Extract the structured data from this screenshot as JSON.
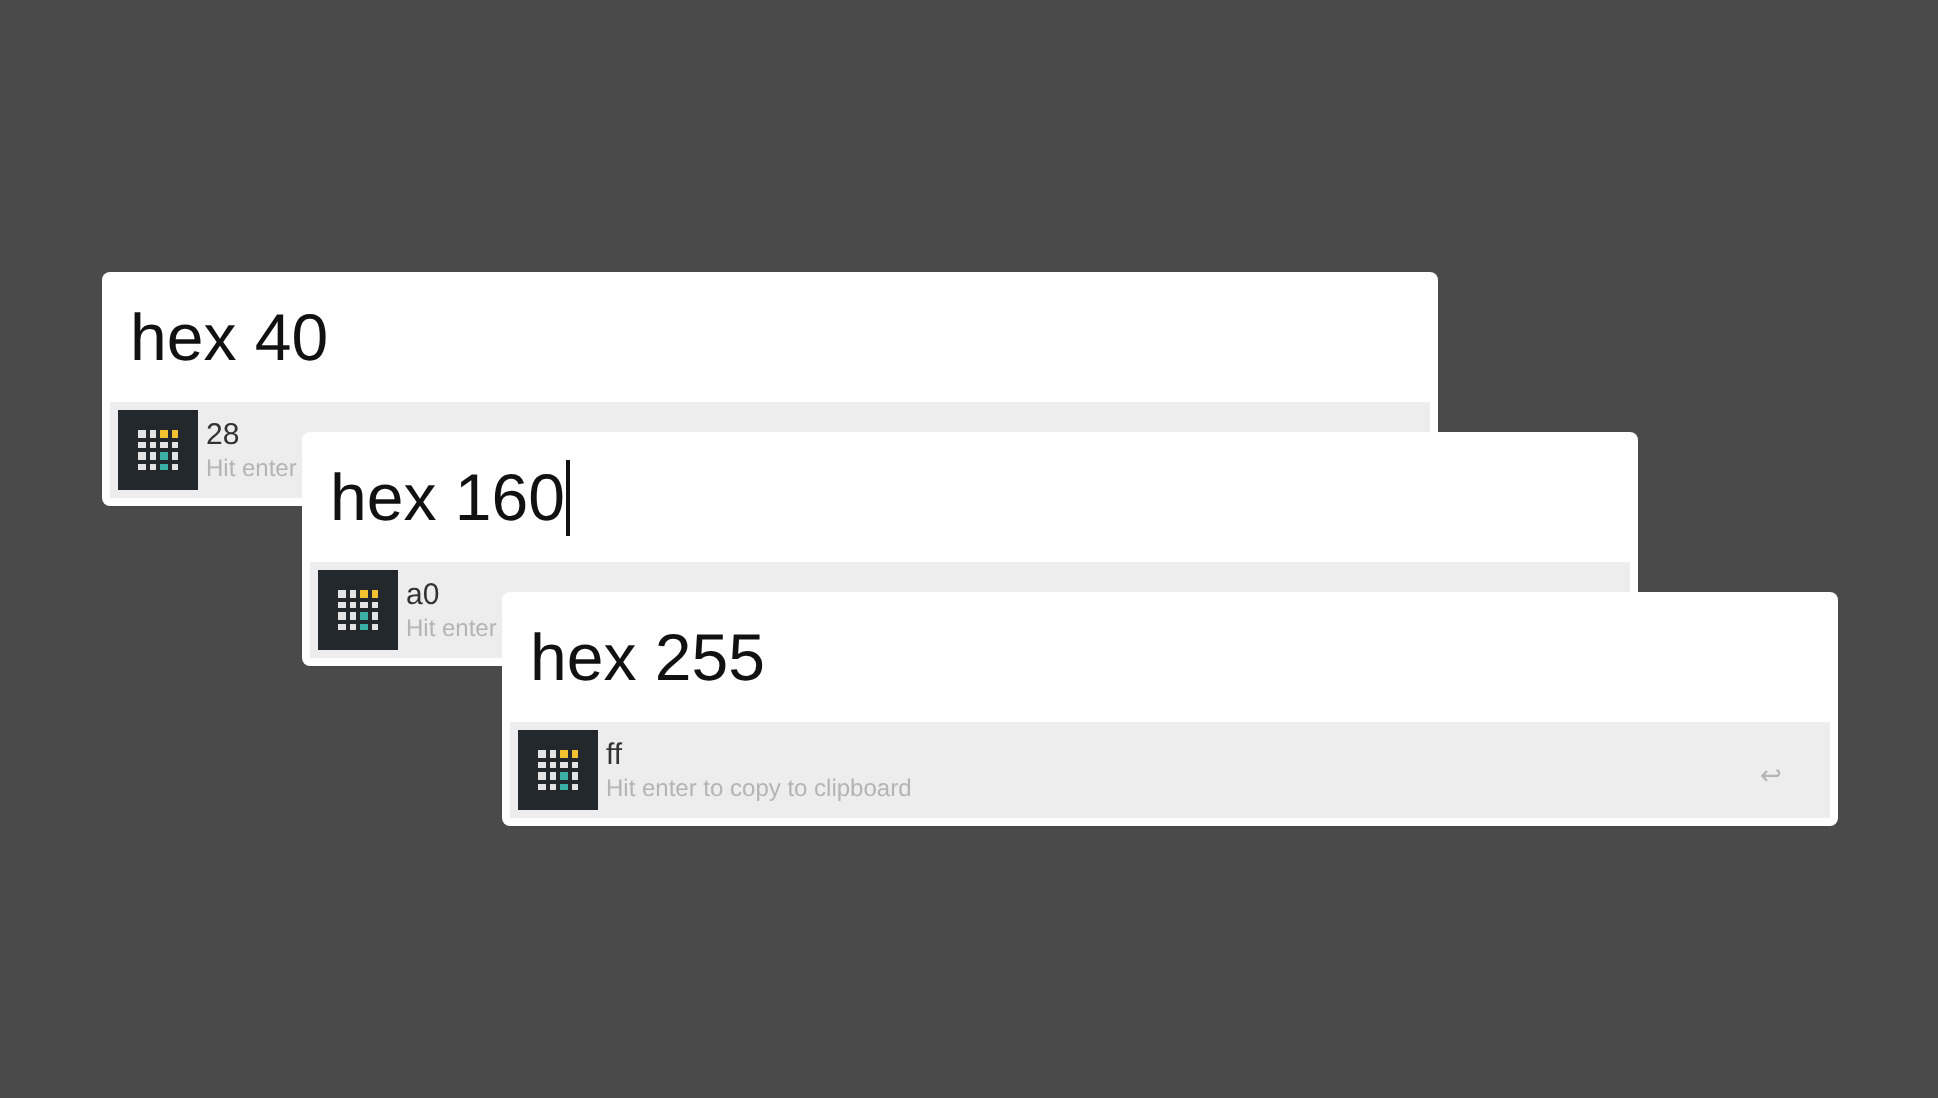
{
  "windows": [
    {
      "query": "hex 40",
      "cursor": false,
      "result": {
        "title": "28",
        "subtitle": "Hit enter"
      }
    },
    {
      "query": "hex 160",
      "cursor": true,
      "result": {
        "title": "a0",
        "subtitle": "Hit enter"
      }
    },
    {
      "query": "hex 255",
      "cursor": false,
      "result": {
        "title": "ff",
        "subtitle": "Hit enter to copy to clipboard",
        "enter_glyph": "↩"
      }
    }
  ]
}
